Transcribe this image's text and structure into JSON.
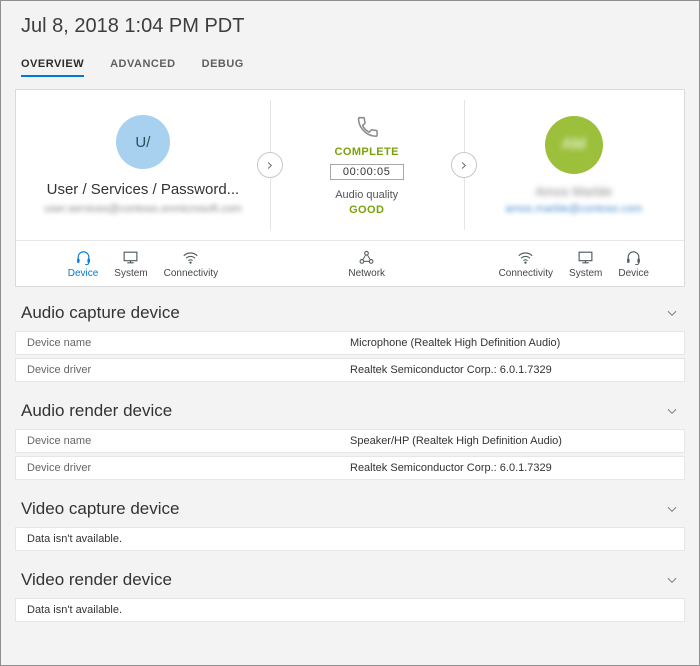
{
  "page": {
    "title": "Jul 8, 2018 1:04 PM PDT"
  },
  "tabs": [
    {
      "label": "OVERVIEW",
      "active": true
    },
    {
      "label": "ADVANCED",
      "active": false
    },
    {
      "label": "DEBUG",
      "active": false
    }
  ],
  "colors": {
    "accent_blue": "#0078d4",
    "status_green": "#7aa30a",
    "caller_avatar_blue": "#a7d1ee",
    "callee_avatar_green": "#9cc03c"
  },
  "call_card": {
    "caller": {
      "initials": "U/",
      "name": "User / Services / Password...",
      "email_blurred": "user.services@contoso.onmicrosoft.com"
    },
    "callee": {
      "initials": "AM",
      "name_blurred": "Amos Marble",
      "email_blurred": "amos.marble@contoso.com"
    },
    "status": {
      "state": "COMPLETE",
      "duration": "00:00:05",
      "audio_quality_label": "Audio quality",
      "audio_quality_value": "GOOD"
    },
    "footer_tabs": {
      "caller": [
        {
          "label": "Device",
          "icon": "headset-icon",
          "active": true
        },
        {
          "label": "System",
          "icon": "monitor-icon",
          "active": false
        },
        {
          "label": "Connectivity",
          "icon": "wifi-icon",
          "active": false
        }
      ],
      "middle": [
        {
          "label": "Network",
          "icon": "network-icon",
          "active": false
        }
      ],
      "callee": [
        {
          "label": "Connectivity",
          "icon": "wifi-icon",
          "active": false
        },
        {
          "label": "System",
          "icon": "monitor-icon",
          "active": false
        },
        {
          "label": "Device",
          "icon": "headset-icon",
          "active": false
        }
      ]
    }
  },
  "sections": [
    {
      "title": "Audio capture device",
      "rows": [
        {
          "label": "Device name",
          "value": "Microphone (Realtek High Definition Audio)"
        },
        {
          "label": "Device driver",
          "value": "Realtek Semiconductor Corp.: 6.0.1.7329"
        }
      ]
    },
    {
      "title": "Audio render device",
      "rows": [
        {
          "label": "Device name",
          "value": "Speaker/HP (Realtek High Definition Audio)"
        },
        {
          "label": "Device driver",
          "value": "Realtek Semiconductor Corp.: 6.0.1.7329"
        }
      ]
    },
    {
      "title": "Video capture device",
      "rows": [],
      "empty": "Data isn't available."
    },
    {
      "title": "Video render device",
      "rows": [],
      "empty": "Data isn't available."
    }
  ]
}
